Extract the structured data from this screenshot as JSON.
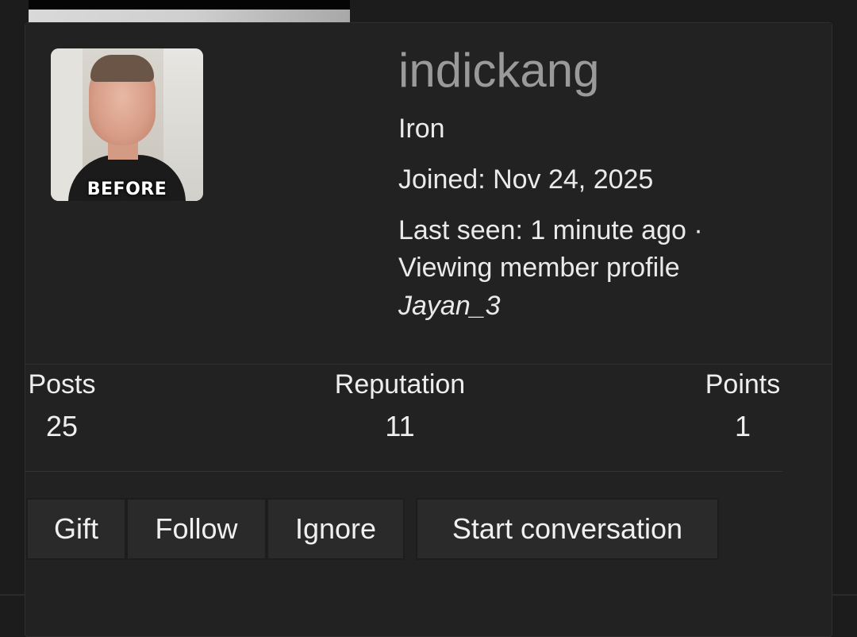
{
  "member": {
    "username": "indickang",
    "rank": "Iron",
    "joined": "Joined: Nov 24, 2025",
    "last_seen": "Last seen: 1 minute ago ·",
    "activity": "Viewing member profile",
    "activity_target": "Jayan_3",
    "avatar_caption": "BEFORE"
  },
  "stats": {
    "posts_label": "Posts",
    "posts_value": "25",
    "reputation_label": "Reputation",
    "reputation_value": "11",
    "points_label": "Points",
    "points_value": "1"
  },
  "actions": {
    "gift": "Gift",
    "follow": "Follow",
    "ignore": "Ignore",
    "start_conversation": "Start conversation"
  },
  "colors": {
    "card_background": "#222222",
    "page_background": "#1c1c1c",
    "username_gray": "#9a9a9a",
    "button_background": "#2a2a2a"
  }
}
